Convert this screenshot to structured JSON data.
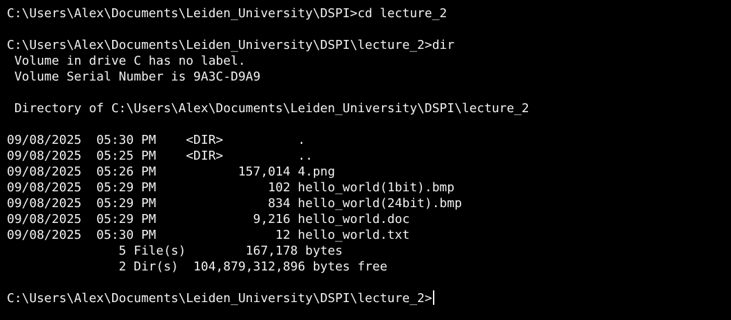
{
  "terminal": {
    "colors": {
      "background": "#000000",
      "foreground": "#f2f2f2"
    },
    "lines": [
      "C:\\Users\\Alex\\Documents\\Leiden_University\\DSPI>cd lecture_2",
      "",
      "C:\\Users\\Alex\\Documents\\Leiden_University\\DSPI\\lecture_2>dir",
      " Volume in drive C has no label.",
      " Volume Serial Number is 9A3C-D9A9",
      "",
      " Directory of C:\\Users\\Alex\\Documents\\Leiden_University\\DSPI\\lecture_2",
      "",
      "09/08/2025  05:30 PM    <DIR>          .",
      "09/08/2025  05:25 PM    <DIR>          ..",
      "09/08/2025  05:26 PM           157,014 4.png",
      "09/08/2025  05:29 PM               102 hello_world(1bit).bmp",
      "09/08/2025  05:29 PM               834 hello_world(24bit).bmp",
      "09/08/2025  05:29 PM             9,216 hello_world.doc",
      "09/08/2025  05:30 PM                12 hello_world.txt",
      "               5 File(s)        167,178 bytes",
      "               2 Dir(s)  104,879,312,896 bytes free",
      ""
    ],
    "prompt": "C:\\Users\\Alex\\Documents\\Leiden_University\\DSPI\\lecture_2>"
  }
}
